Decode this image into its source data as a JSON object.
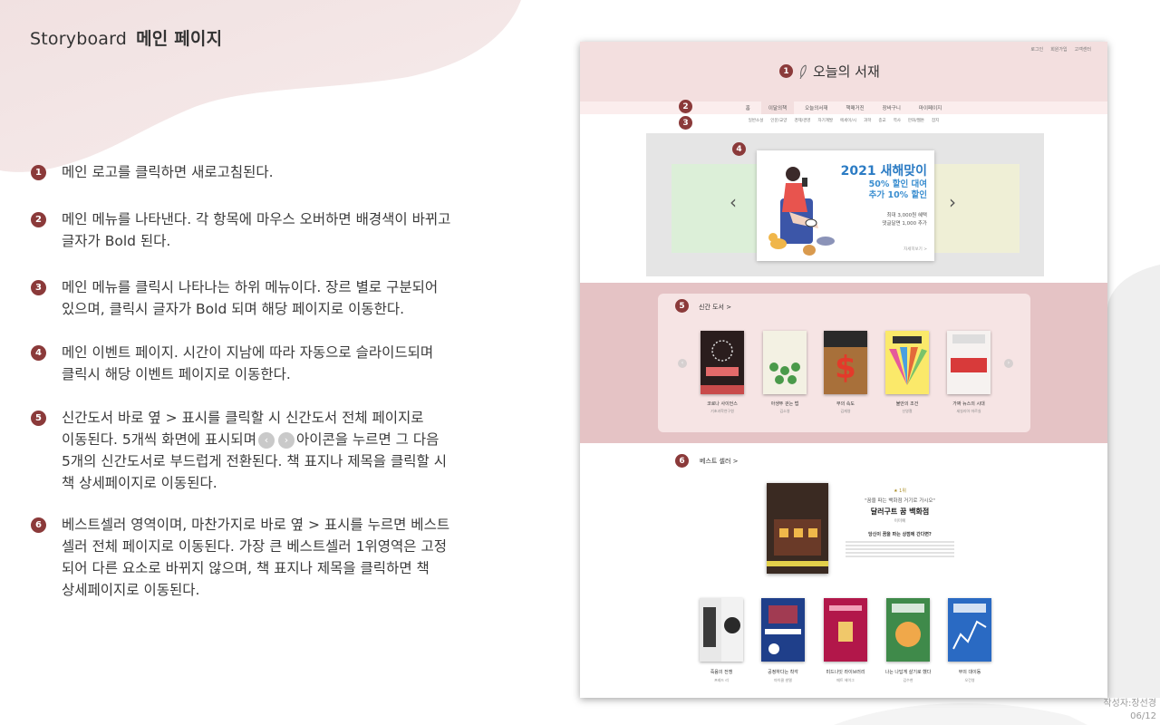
{
  "slide": {
    "title_prefix": "Storyboard",
    "title_main": "메인 페이지",
    "author": "작성자:장선경",
    "page": "06/12"
  },
  "notes": [
    {
      "num": "1",
      "text": "메인 로고를 클릭하면 새로고침된다."
    },
    {
      "num": "2",
      "text": "메인 메뉴를 나타낸다. 각 항목에 마우스 오버하면 배경색이 바뀌고\n글자가 Bold 된다."
    },
    {
      "num": "3",
      "text": "메인 메뉴를 클릭시 나타나는 하위 메뉴이다. 장르 별로 구분되어\n있으며, 클릭시 글자가 Bold 되며 해당 페이지로 이동한다."
    },
    {
      "num": "4",
      "text": "메인 이벤트 페이지. 시간이 지남에 따라 자동으로 슬라이드되며\n클릭시 해당 이벤트 페이지로 이동한다."
    },
    {
      "num": "5",
      "text_a": "신간도서 바로 옆 > 표시를 클릭할 시 신간도서 전체 페이지로\n이동된다. 5개씩 화면에 표시되며",
      "text_b": "아이콘을 누르면 그 다음\n5개의 신간도서로 부드럽게 전환된다. 책 표지나 제목을 클릭할 시\n책 상세페이지로 이동된다."
    },
    {
      "num": "6",
      "text": "베스트셀러 영역이며, 마찬가지로 바로 옆 > 표시를 누르면 베스트\n셀러 전체 페이지로 이동된다. 가장 큰 베스트셀러 1위영역은 고정\n되어 다른 요소로 바뀌지 않으며, 책 표지나 제목을 클릭하면 책\n상세페이지로 이동된다."
    }
  ],
  "mockup": {
    "util_links": [
      "로그인",
      "회원가입",
      "고객센터"
    ],
    "logo_text": "오늘의 서재",
    "nav": [
      "홈",
      "이달의책",
      "오늘의서재",
      "책매거진",
      "장바구니",
      "마이페이지"
    ],
    "sub_nav": [
      "일반소설",
      "인문/교양",
      "경제/경영",
      "자기계발",
      "에세이/시",
      "과학",
      "종교",
      "역사",
      "만화/웹툰",
      "잡지"
    ],
    "markers": [
      "1",
      "2",
      "3",
      "4",
      "5",
      "6"
    ],
    "event": {
      "title": "2021 새해맞이",
      "line1": "50% 할인 대여",
      "line2": "추가 10% 할인",
      "note1": "최대 3,000원 혜택",
      "note2": "댓글달면 1,000 추가",
      "more": "자세히보기 >"
    },
    "new_books": {
      "title": "신간 도서  >",
      "books": [
        {
          "title": "코로나 사이언스",
          "author": "기초과학연구원"
        },
        {
          "title": "아생뚜 걷는 법",
          "author": "김소영"
        },
        {
          "title": "부의 속도",
          "author": "김재영"
        },
        {
          "title": "불안의 조건",
          "author": "신영철"
        },
        {
          "title": "가짜 뉴스의 시대",
          "author": "세실리아 마르실"
        }
      ]
    },
    "best": {
      "title": "베스트 셀러  >",
      "top_rank": "1위",
      "top_quote": "\"꿈을 파는 백화점 거기로 가시오\"",
      "top_title": "달러구트 꿈 백화점",
      "top_author": "이미예",
      "top_desc": "당신이 꿈을 파는 상점에 간다면?",
      "books": [
        {
          "title": "죽음의 전쟁",
          "author": "프레드 리"
        },
        {
          "title": "공정하다는 착각",
          "author": "마이클 샌델"
        },
        {
          "title": "미드나잇 라이브러리",
          "author": "매트 헤이그"
        },
        {
          "title": "나는 나답게 살기로 했다",
          "author": "김수현"
        },
        {
          "title": "부의 대이동",
          "author": "오건영"
        }
      ]
    }
  },
  "colors": {
    "accent": "#8b3a3a",
    "header_bg": "#f3dfdf",
    "new_section_bg": "#e5c3c5",
    "event_title": "#2c7cc4"
  }
}
